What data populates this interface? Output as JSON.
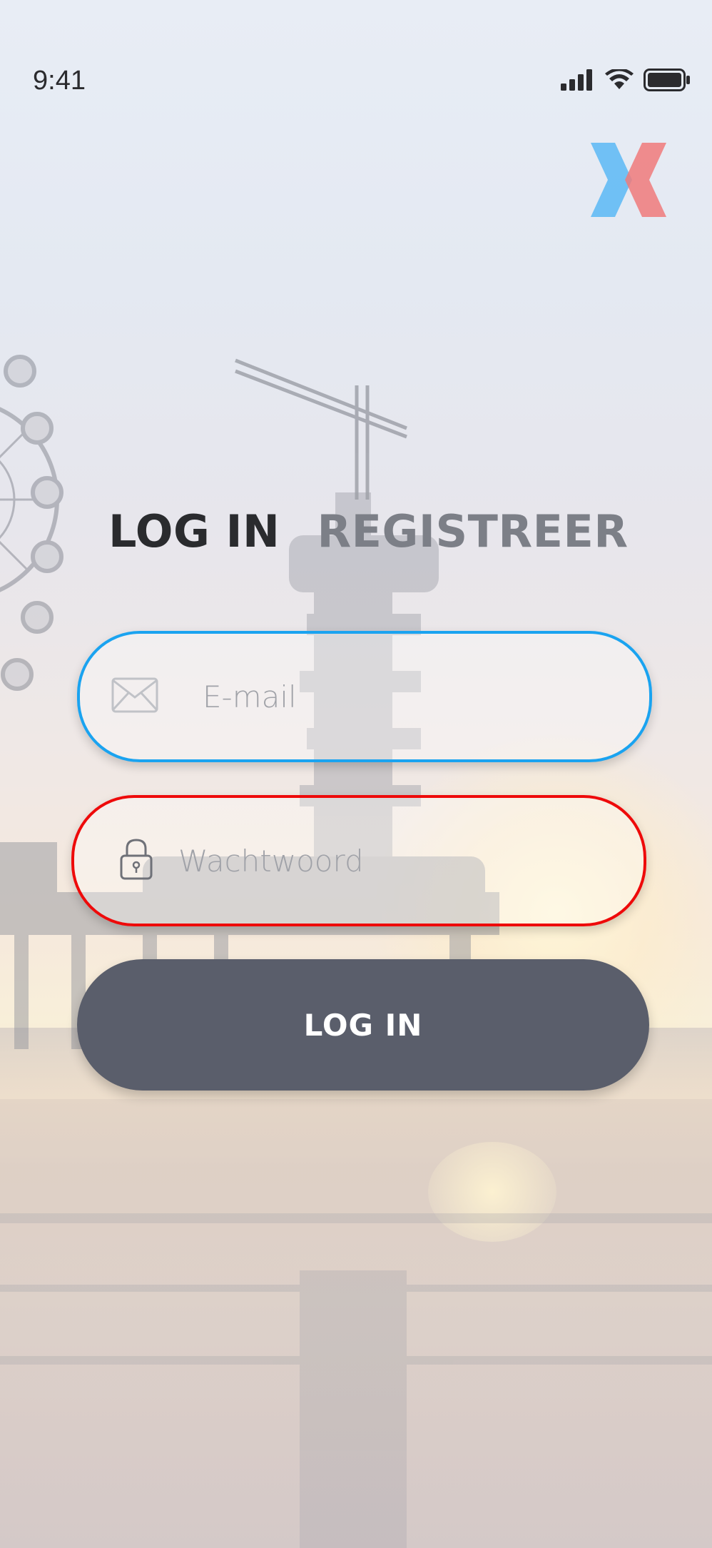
{
  "status_bar": {
    "time": "9:41",
    "icons": [
      "cellular-signal-icon",
      "wifi-icon",
      "battery-icon"
    ]
  },
  "logo": {
    "icon": "x-logo-icon",
    "colors": [
      "#5ab8f4",
      "#f07a7a"
    ]
  },
  "tabs": [
    {
      "label": "LOG IN",
      "active": true
    },
    {
      "label": "REGISTREER",
      "active": false
    }
  ],
  "form": {
    "email": {
      "placeholder": "E-mail",
      "value": "",
      "icon": "envelope-icon",
      "border_color": "#1aa3f0"
    },
    "password": {
      "placeholder": "Wachtwoord",
      "value": "",
      "icon": "padlock-icon",
      "border_color": "#ee0a0a"
    },
    "submit_label": "LOG IN"
  },
  "colors": {
    "button_bg": "#5a5e6b",
    "tab_active": "#2a2b2e",
    "tab_inactive": "#7c7f87"
  }
}
